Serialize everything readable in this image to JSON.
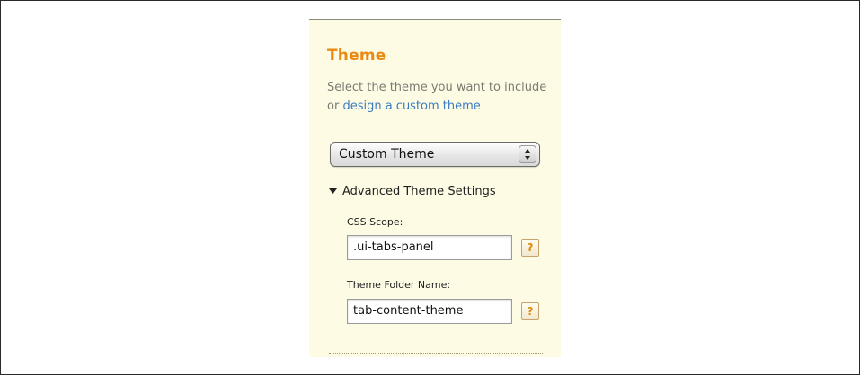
{
  "panel": {
    "title": "Theme",
    "description_prefix": "Select the theme you want to include or ",
    "description_link": "design a custom theme",
    "theme_select": {
      "selected": "Custom Theme"
    },
    "advanced": {
      "label": "Advanced Theme Settings",
      "css_scope": {
        "label": "CSS Scope:",
        "value": ".ui-tabs-panel",
        "help": "?"
      },
      "folder_name": {
        "label": "Theme Folder Name:",
        "value": "tab-content-theme",
        "help": "?"
      }
    }
  },
  "colors": {
    "panel_bg": "#fdfbe4",
    "title": "#ea8a12",
    "link": "#3a7bbf"
  }
}
